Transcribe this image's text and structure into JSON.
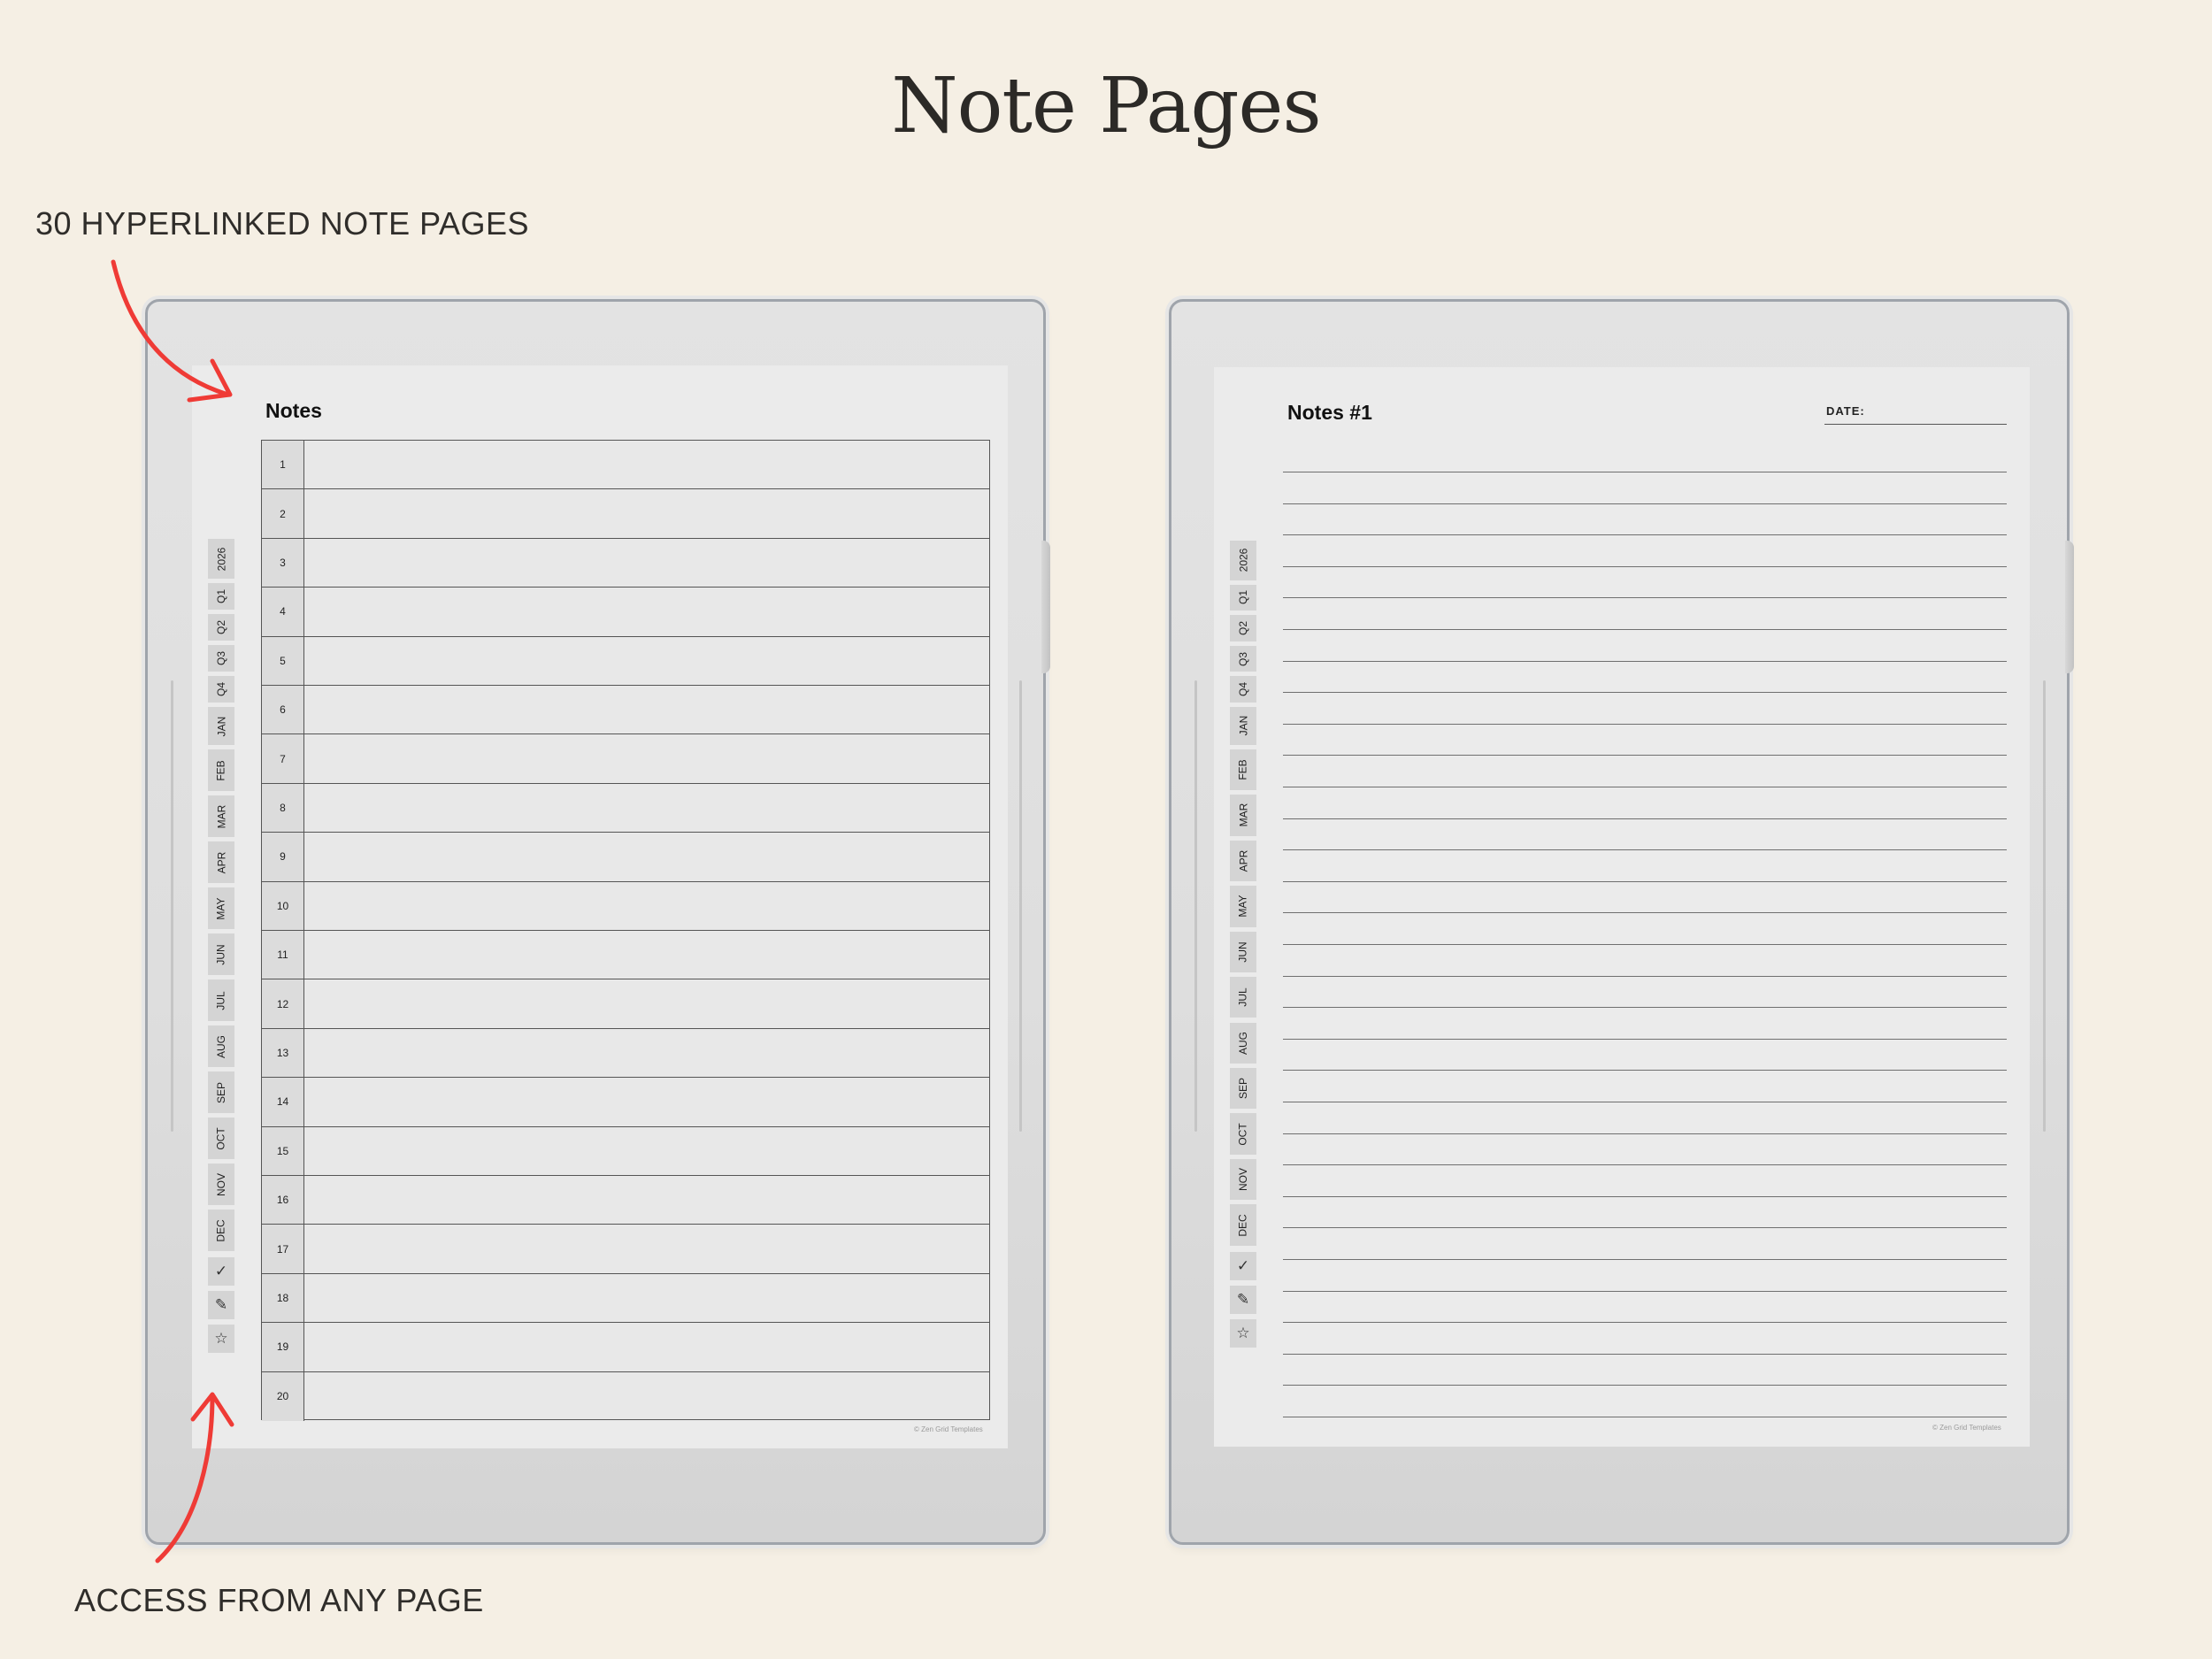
{
  "title": "Note Pages",
  "callouts": {
    "top": "30 HYPERLINKED NOTE PAGES",
    "bottom": "ACCESS FROM ANY PAGE"
  },
  "nav_tabs": [
    "2026",
    "Q1",
    "Q2",
    "Q3",
    "Q4",
    "JAN",
    "FEB",
    "MAR",
    "APR",
    "MAY",
    "JUN",
    "JUL",
    "AUG",
    "SEP",
    "OCT",
    "NOV",
    "DEC"
  ],
  "nav_icons": [
    {
      "name": "checkmark-icon",
      "glyph": "✓"
    },
    {
      "name": "pencil-icon",
      "glyph": "✎"
    },
    {
      "name": "star-icon",
      "glyph": "☆"
    }
  ],
  "left_page": {
    "heading": "Notes",
    "rows": [
      "1",
      "2",
      "3",
      "4",
      "5",
      "6",
      "7",
      "8",
      "9",
      "10",
      "11",
      "12",
      "13",
      "14",
      "15",
      "16",
      "17",
      "18",
      "19",
      "20"
    ],
    "copyright": "© Zen Grid Templates"
  },
  "right_page": {
    "heading": "Notes #1",
    "date_label": "DATE:",
    "copyright": "© Zen Grid Templates"
  },
  "colors": {
    "background": "#f5efe4",
    "arrow": "#ef3b36",
    "device_frame": "#9fa4ab",
    "screen": "#ebebeb"
  }
}
